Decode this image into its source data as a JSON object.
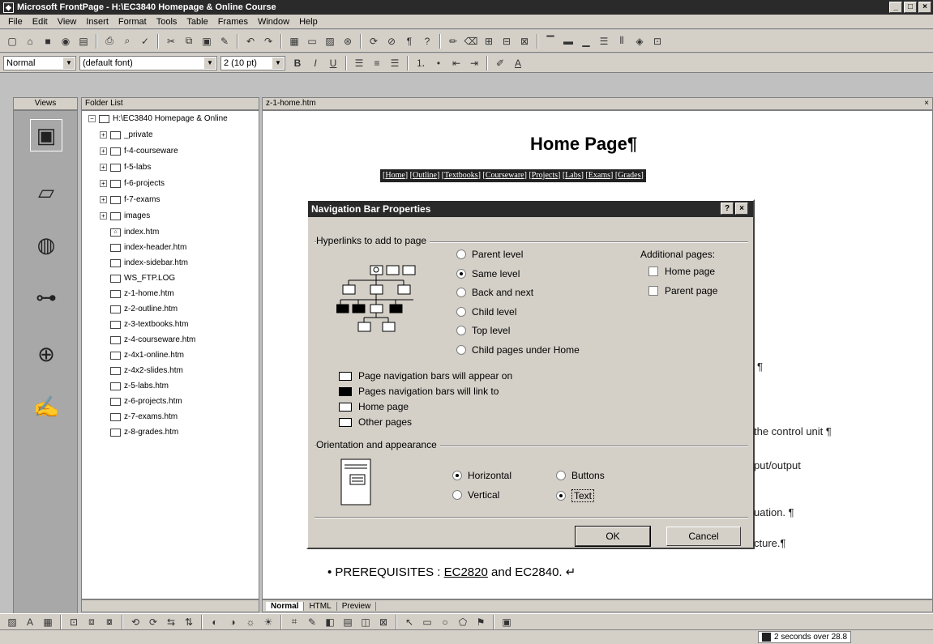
{
  "window": {
    "title": "Microsoft FrontPage - H:\\EC3840 Homepage & Online Course",
    "min_label": "_",
    "max_label": "□",
    "close_label": "×"
  },
  "menu": [
    "File",
    "Edit",
    "View",
    "Insert",
    "Format",
    "Tools",
    "Table",
    "Frames",
    "Window",
    "Help"
  ],
  "format_toolbar": {
    "style": "Normal",
    "font": "(default font)",
    "size": "2 (10 pt)",
    "bold": "B",
    "italic": "I",
    "underline": "U"
  },
  "views": {
    "header": "Views",
    "items": [
      "page-view-icon",
      "folders-view-icon",
      "reports-view-icon",
      "navigation-view-icon",
      "hyperlinks-view-icon",
      "tasks-view-icon"
    ]
  },
  "folder_list": {
    "header": "Folder List",
    "root": "H:\\EC3840 Homepage & Online",
    "folders": [
      "_private",
      "f-4-courseware",
      "f-5-labs",
      "f-6-projects",
      "f-7-exams",
      "images"
    ],
    "files": [
      "index.htm",
      "index-header.htm",
      "index-sidebar.htm",
      "WS_FTP.LOG",
      "z-1-home.htm",
      "z-2-outline.htm",
      "z-3-textbooks.htm",
      "z-4-courseware.htm",
      "z-4x1-online.htm",
      "z-4x2-slides.htm",
      "z-5-labs.htm",
      "z-6-projects.htm",
      "z-7-exams.htm",
      "z-8-grades.htm"
    ]
  },
  "editor": {
    "tab": "z-1-home.htm",
    "close_label": "×",
    "title": "Home Page¶",
    "nav_links": [
      "Home",
      "Outline",
      "Textbooks",
      "Courseware",
      "Projects",
      "Labs",
      "Exams",
      "Grades"
    ],
    "nav_open": "[",
    "nav_sep": "] [",
    "nav_close": "]",
    "pilcrow": "¶",
    "fragments": [
      "the control unit ¶",
      "put/output",
      "uation. ¶",
      "cture.¶"
    ],
    "prereq_prefix": "• PREREQUISITES : ",
    "prereq_link": "EC2820",
    "prereq_suffix": " and EC2840. ↵",
    "view_tabs": [
      "Normal",
      "HTML",
      "Preview"
    ]
  },
  "dialog": {
    "title": "Navigation Bar Properties",
    "help_label": "?",
    "close_label": "×",
    "hyperlinks_group": "Hyperlinks to add to page",
    "levels": [
      {
        "label": "Parent level",
        "selected": false
      },
      {
        "label": "Same level",
        "selected": true
      },
      {
        "label": "Back and next",
        "selected": false
      },
      {
        "label": "Child level",
        "selected": false
      },
      {
        "label": "Top level",
        "selected": false
      },
      {
        "label": "Child pages under Home",
        "selected": false
      }
    ],
    "additional_pages": {
      "label": "Additional pages:",
      "items": [
        {
          "label": "Home page",
          "checked": false
        },
        {
          "label": "Parent page",
          "checked": false
        }
      ]
    },
    "legend": [
      "Page navigation bars will appear on",
      "Pages navigation bars will link to",
      "Home page",
      "Other pages"
    ],
    "orientation_group": "Orientation and appearance",
    "orientation": [
      {
        "label": "Horizontal",
        "selected": true
      },
      {
        "label": "Vertical",
        "selected": false
      }
    ],
    "appearance": [
      {
        "label": "Buttons",
        "selected": false
      },
      {
        "label": "Text",
        "selected": true
      }
    ],
    "ok_label": "OK",
    "cancel_label": "Cancel"
  },
  "status": {
    "text": "2 seconds over 28.8"
  }
}
